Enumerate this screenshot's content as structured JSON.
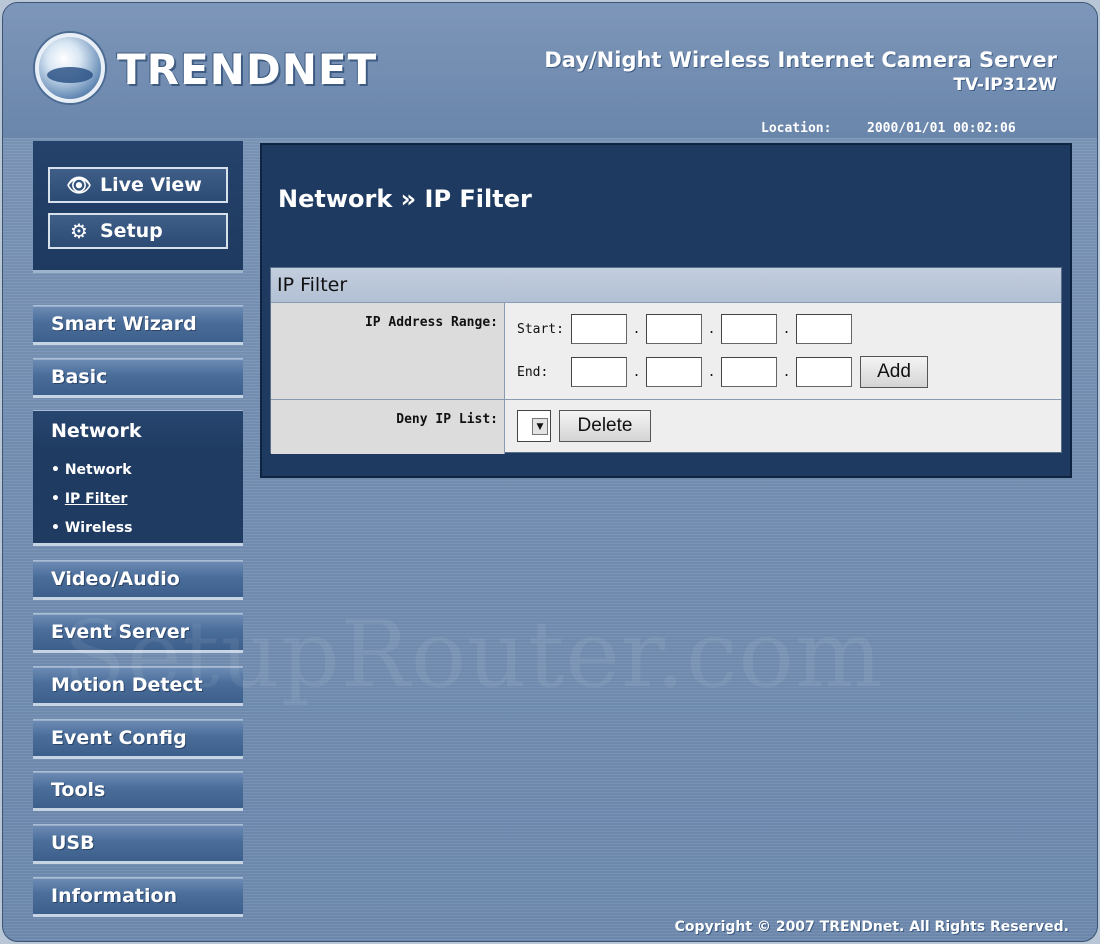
{
  "header": {
    "logo_text": "TRENDNET",
    "product_title": "Day/Night Wireless Internet Camera Server",
    "model": "TV-IP312W",
    "location_label": "Location:",
    "location_value": "2000/01/01 00:02:06"
  },
  "view_buttons": {
    "live_view": "Live View",
    "setup": "Setup"
  },
  "nav": {
    "items": [
      "Smart Wizard",
      "Basic",
      "Network",
      "Video/Audio",
      "Event Server",
      "Motion Detect",
      "Event Config",
      "Tools",
      "USB",
      "Information"
    ],
    "active": "Network",
    "subitems": [
      "Network",
      "IP Filter",
      "Wireless"
    ],
    "current_subitem": "IP Filter"
  },
  "main": {
    "heading": "Network » IP Filter",
    "section_title": "IP Filter",
    "ip_range_label": "IP Address Range:",
    "start_label": "Start:",
    "end_label": "End:",
    "dot": ".",
    "add_label": "Add",
    "deny_label": "Deny IP List:",
    "delete_label": "Delete",
    "start_values": [
      "",
      "",
      "",
      ""
    ],
    "end_values": [
      "",
      "",
      "",
      ""
    ]
  },
  "watermark": "SetupRouter.com",
  "footer": {
    "copyright": "Copyright © 2007 TRENDnet. All Rights Reserved."
  },
  "colors": {
    "panel_navy": "#1f3a60",
    "frame_blue": "#7590b4",
    "section_bg": "#eeeeee"
  }
}
